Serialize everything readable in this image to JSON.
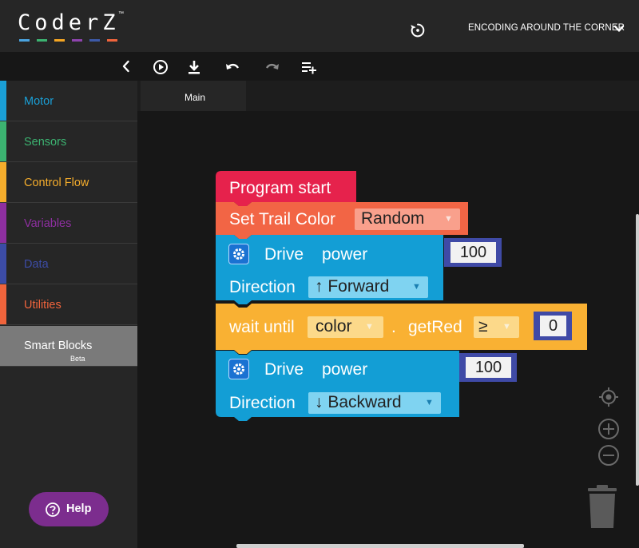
{
  "header": {
    "logo_text": "CoderZ",
    "logo_tm": "™",
    "logo_colors": [
      "#4aa3df",
      "#3cb371",
      "#f5a623",
      "#8e44ad",
      "#3d5aa8",
      "#f0643c"
    ],
    "mission_title": "ENCODING AROUND THE CORNER",
    "icons": {
      "reset": "reset-icon",
      "chevron": "chevron-down-icon"
    }
  },
  "toolbar": {
    "icons": [
      "play-icon",
      "download-icon",
      "undo-icon",
      "redo-icon",
      "add-list-icon"
    ],
    "collapse_icon": "chevron-left-icon"
  },
  "sidebar": {
    "categories": [
      {
        "label": "Motor",
        "color": "#1a9fd6"
      },
      {
        "label": "Sensors",
        "color": "#3cb371"
      },
      {
        "label": "Control Flow",
        "color": "#f5ad2c"
      },
      {
        "label": "Variables",
        "color": "#8e2fa0"
      },
      {
        "label": "Data",
        "color": "#3c4ca6"
      },
      {
        "label": "Utilities",
        "color": "#f0643c"
      }
    ],
    "smart_blocks": {
      "label": "Smart Blocks",
      "badge": "Beta"
    },
    "help_label": "Help"
  },
  "tabs": [
    {
      "label": "Main"
    }
  ],
  "blocks": {
    "program_start": "Program start",
    "trail": {
      "label": "Set Trail Color",
      "value": "Random"
    },
    "drive1": {
      "label_drive": "Drive",
      "label_power": "power",
      "power": "100",
      "direction_label": "Direction",
      "direction_value": "↑ Forward"
    },
    "wait": {
      "label": "wait until",
      "sensor": "color",
      "dot": ".",
      "method": "getRed",
      "operator": "≥",
      "value": "0"
    },
    "drive2": {
      "label_drive": "Drive",
      "label_power": "power",
      "power": "100",
      "direction_label": "Direction",
      "direction_value": "↓ Backward"
    },
    "colors": {
      "start": "#e6224c",
      "trail": "#f26545",
      "drive": "#139ed5",
      "wait": "#f9b133",
      "number": "#3f4aa6"
    },
    "dropdown_arrow": "▼"
  },
  "workspace_icons": [
    "target-icon",
    "zoom-in-icon",
    "zoom-out-icon",
    "trash-icon"
  ]
}
